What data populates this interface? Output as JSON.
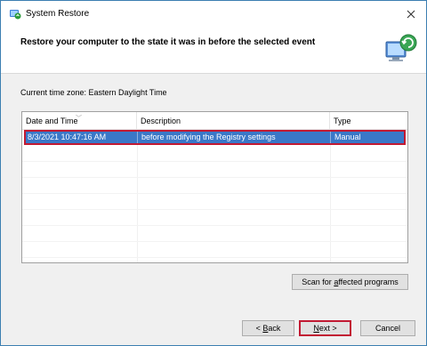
{
  "window": {
    "title": "System Restore",
    "close_glyph": "✕"
  },
  "header": {
    "text": "Restore your computer to the state it was in before the selected event",
    "icon": "system-restore-monitor-icon"
  },
  "timezone_label": "Current time zone: Eastern Daylight Time",
  "table": {
    "columns": [
      "Date and Time",
      "Description",
      "Type"
    ],
    "sorted_column": "Date and Time",
    "rows": [
      {
        "date_time": "8/3/2021 10:47:16 AM",
        "description": "before modifying the Registry settings",
        "type": "Manual",
        "selected": true
      }
    ]
  },
  "buttons": {
    "scan_pre": "Scan for ",
    "scan_accel": "a",
    "scan_post": "ffected programs",
    "back_pre": "< ",
    "back_accel": "B",
    "back_post": "ack",
    "next_accel": "N",
    "next_post": "ext >",
    "cancel": "Cancel"
  },
  "colors": {
    "selection": "#3a78c8",
    "highlight_border": "#c21a33",
    "window_border": "#3c7fb1"
  }
}
